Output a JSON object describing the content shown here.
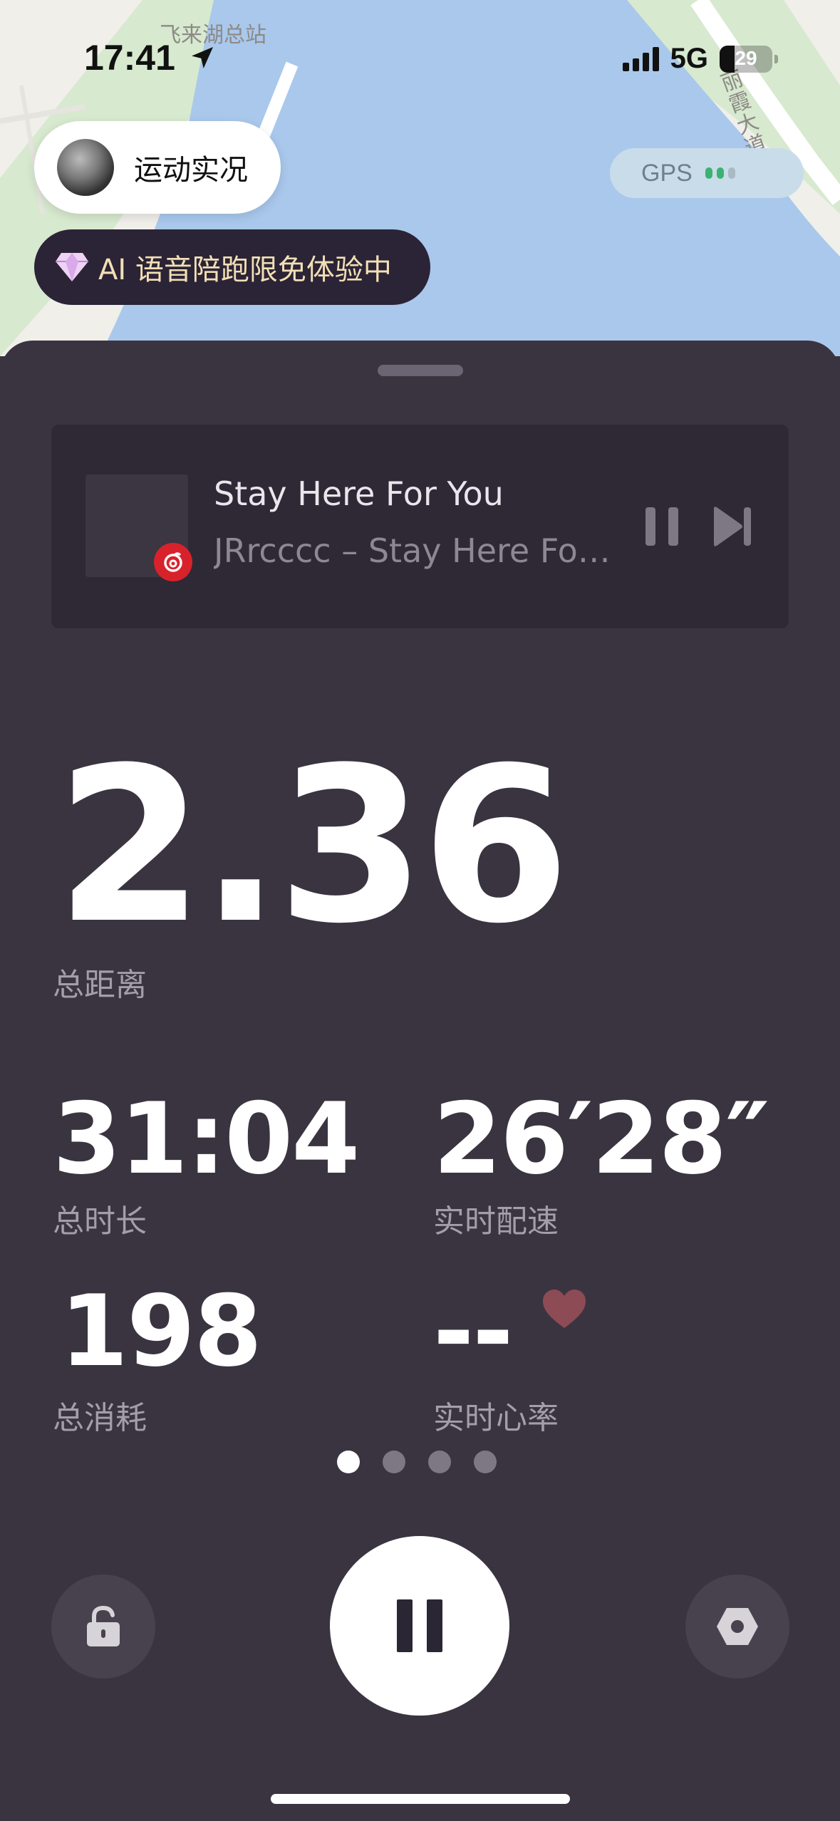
{
  "status_bar": {
    "time": "17:41",
    "network": "5G",
    "battery": "29",
    "battery_level": 0.29
  },
  "map": {
    "labels": {
      "bus_station": "飞来湖总站",
      "street": "丽霞大道"
    },
    "colors": {
      "land": "#f0efea",
      "water": "#a9c8ec",
      "park": "#cfe3c8"
    }
  },
  "live_chip": {
    "label": "运动实况"
  },
  "gps_chip": {
    "label": "GPS",
    "signal_colors": [
      "#3bb271",
      "#3bb271",
      "#a9bac6"
    ]
  },
  "ai_chip": {
    "label": "AI 语音陪跑限免体验中"
  },
  "music": {
    "title": "Stay Here For You",
    "artist_line": "JRrcccc – Stay Here For You",
    "source_icon": "netease-music-icon"
  },
  "metrics": {
    "distance": {
      "value": "2.36",
      "label": "总距离"
    },
    "duration": {
      "value": "31:04",
      "label": "总时长"
    },
    "pace": {
      "value": "26′28″",
      "label": "实时配速"
    },
    "calories": {
      "value": "198",
      "label": "总消耗"
    },
    "heart_rate": {
      "value": "--",
      "label": "实时心率"
    }
  },
  "pager": {
    "count": 4,
    "active_index": 0
  },
  "controls": {
    "lock": "lock-icon",
    "pause": "pause-icon",
    "settings": "hexagon-settings-icon"
  },
  "colors": {
    "panel": "#3a3441",
    "accent_text": "#f3dfb6",
    "heart": "#8c4b55",
    "netease_red": "#d8222b"
  }
}
